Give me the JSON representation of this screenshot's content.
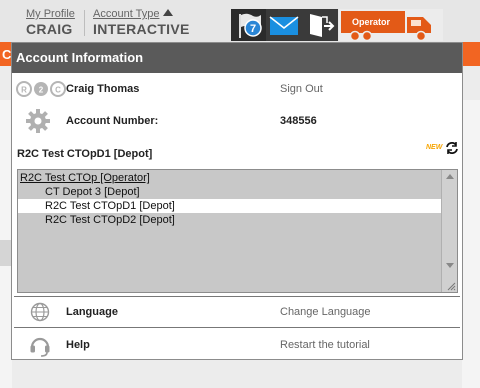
{
  "header": {
    "my_profile_label": "My Profile",
    "user_short": "CRAIG",
    "account_type_label": "Account Type",
    "account_type_value": "INTERACTIVE",
    "flag_count": "7",
    "truck_label": "Operator"
  },
  "crumb": "CRAIG",
  "panel": {
    "title": "Account Information",
    "logo_text": "R2C",
    "user_name": "Craig Thomas",
    "sign_out": "Sign Out",
    "account_number_label": "Account Number:",
    "account_number": "348556",
    "current_depot": "R2C Test CTOpD1 [Depot]",
    "new_badge": "NEW",
    "depots": [
      {
        "label": "R2C Test CTOp [Operator]"
      },
      {
        "label": "CT Depot 3 [Depot]"
      },
      {
        "label": "R2C Test CTOpD1 [Depot]"
      },
      {
        "label": "R2C Test CTOpD2 [Depot]"
      }
    ],
    "language_label": "Language",
    "change_language": "Change Language",
    "help_label": "Help",
    "restart_tutorial": "Restart the tutorial"
  },
  "colors": {
    "accent": "#f26522",
    "header_dark": "#5a5a5a",
    "icon_bg": "#3a3a3a",
    "mail_blue": "#1a8fe0"
  }
}
